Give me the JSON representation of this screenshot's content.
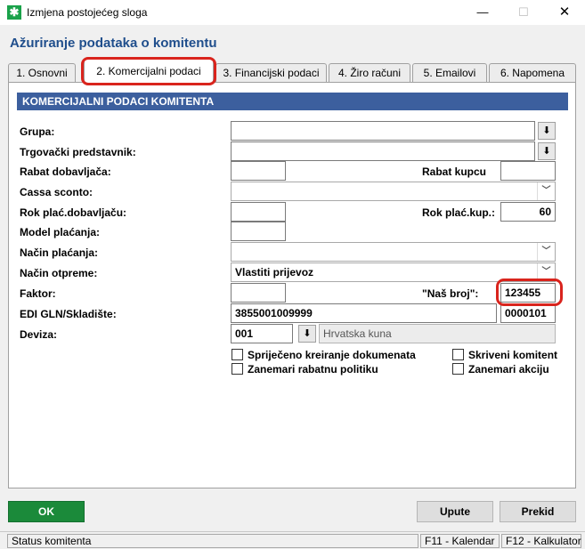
{
  "window": {
    "title": "Izmjena postojećeg sloga",
    "minimize": "—",
    "maximize": "☐",
    "close": "✕"
  },
  "heading": "Ažuriranje podataka o komitentu",
  "tabs": [
    {
      "label": "1. Osnovni"
    },
    {
      "label": "2. Komercijalni podaci"
    },
    {
      "label": "3. Financijski podaci"
    },
    {
      "label": "4. Žiro računi"
    },
    {
      "label": "5. Emailovi"
    },
    {
      "label": "6. Napomena"
    }
  ],
  "active_tab": 1,
  "section_title": "KOMERCIJALNI PODACI KOMITENTA",
  "fields": {
    "grupa": {
      "label": "Grupa:",
      "value": ""
    },
    "trgovacki_predstavnik": {
      "label": "Trgovački predstavnik:",
      "value": ""
    },
    "rabat_dobavljaca": {
      "label": "Rabat dobavljača:",
      "value": ""
    },
    "rabat_kupcu": {
      "label": "Rabat kupcu",
      "value": ""
    },
    "cassa_sconto": {
      "label": "Cassa sconto:",
      "value": ""
    },
    "rok_plac_dobavljacu": {
      "label": "Rok plać.dobavljaču:",
      "value": ""
    },
    "rok_plac_kup": {
      "label": "Rok plać.kup.:",
      "value": "60"
    },
    "model_placanja": {
      "label": "Model plaćanja:",
      "value": ""
    },
    "nacin_placanja": {
      "label": "Način plaćanja:",
      "value": ""
    },
    "nacin_otpreme": {
      "label": "Način otpreme:",
      "value": "Vlastiti prijevoz"
    },
    "faktor": {
      "label": "Faktor:",
      "value": ""
    },
    "nas_broj": {
      "label": "\"Naš broj\":",
      "value": "123455"
    },
    "edi_gln": {
      "label": "EDI GLN/Skladište:",
      "value": "3855001009999",
      "skladiste": "0000101"
    },
    "deviza": {
      "label": "Deviza:",
      "code": "001",
      "name": "Hrvatska kuna"
    }
  },
  "checkboxes": [
    {
      "label": "Spriječeno kreiranje dokumenata",
      "checked": false
    },
    {
      "label": "Zanemari rabatnu politiku",
      "checked": false
    },
    {
      "label": "Skriveni komitent",
      "checked": false
    },
    {
      "label": "Zanemari akciju",
      "checked": false
    }
  ],
  "buttons": {
    "ok": "OK",
    "upute": "Upute",
    "prekid": "Prekid"
  },
  "statusbar": {
    "status": "Status komitenta",
    "f11": "F11 - Kalendar",
    "f12": "F12 - Kalkulator"
  },
  "icons": {
    "app": "app-icon",
    "download": "download-arrow-icon",
    "dropdown": "chevron-down-icon"
  },
  "colors": {
    "heading": "#1f4e8c",
    "section_bar": "#3c5f9e",
    "ok_button": "#1b8a3a",
    "highlight_ring": "#d9241d"
  }
}
